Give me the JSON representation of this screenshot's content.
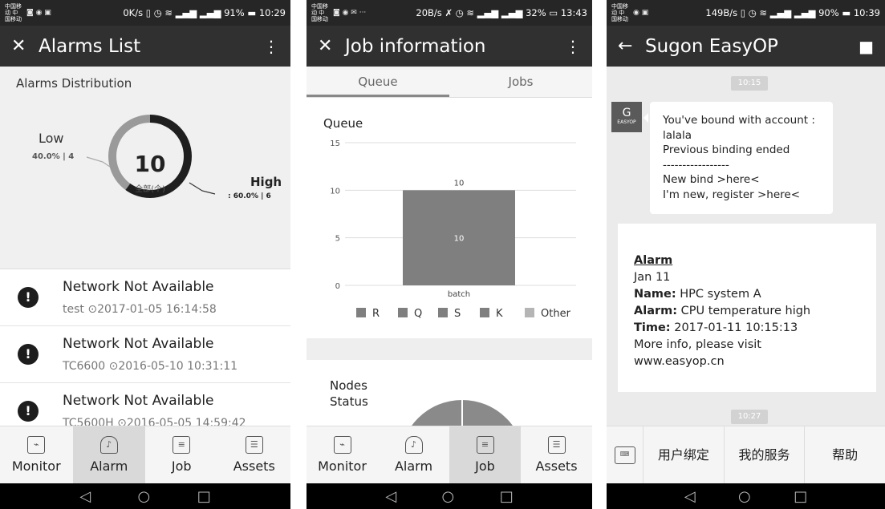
{
  "screens": [
    {
      "status": {
        "carrier": "中国移动\n中国移动",
        "speed": "0K/s",
        "battery": "91%",
        "time": "10:29"
      },
      "appbar": {
        "nav": "✕",
        "title": "Alarms List",
        "menu": "⋮"
      },
      "distribution": {
        "title": "Alarms Distribution",
        "total": "10",
        "unit": "全部(个)",
        "low_label": "Low",
        "low_value": "40.0% | 4",
        "high_label": "High",
        "high_value": ": 60.0% | 6",
        "high_fraction": 0.6
      },
      "alarms": [
        {
          "name": "Network Not Available",
          "meta": "test ⊙2017-01-05 16:14:58"
        },
        {
          "name": "Network Not Available",
          "meta": "TC6600 ⊙2016-05-10 10:31:11"
        },
        {
          "name": "Network Not Available",
          "meta": "TC5600H ⊙2016-05-05 14:59:42"
        }
      ],
      "tabs": [
        "Monitor",
        "Alarm",
        "Job",
        "Assets"
      ],
      "active_tab": "Alarm"
    },
    {
      "status": {
        "carrier": "中国移动\n中国移动",
        "speed": "20B/s",
        "battery": "32%",
        "time": "13:43"
      },
      "appbar": {
        "nav": "✕",
        "title": "Job information",
        "menu": "⋮"
      },
      "top_tabs": [
        "Queue",
        "Jobs"
      ],
      "queue_title": "Queue",
      "nodes_title": "Nodes Status",
      "tabs": [
        "Monitor",
        "Alarm",
        "Job",
        "Assets"
      ],
      "active_tab": "Job"
    },
    {
      "status": {
        "carrier": "中国移动\n中国移动",
        "speed": "149B/s",
        "battery": "90%",
        "time": "10:39"
      },
      "appbar": {
        "nav": "←",
        "title": "Sugon EasyOP",
        "menu": "👤"
      },
      "time1": "10:15",
      "time2": "10:27",
      "avatar_text": "EASYOP",
      "bubble_lines": [
        "You've bound with account :",
        "lalala",
        "Previous binding ended",
        "-----------------",
        "New bind >here<",
        "I'm new, register >here<"
      ],
      "card": {
        "heading": "Alarm",
        "date": "Jan 11",
        "name_label": "Name:",
        "name_value": " HPC system A",
        "alarm_label": "Alarm:",
        "alarm_value": " CPU temperature high",
        "time_label": "Time:",
        "time_value": " 2017-01-11 10:15:13",
        "more": "More info, please visit",
        "url": "www.easyop.cn"
      },
      "menu": [
        "用户绑定",
        "我的服务",
        "帮助"
      ]
    }
  ],
  "chart_data": {
    "type": "bar",
    "title": "Queue",
    "categories": [
      "batch"
    ],
    "series": [
      {
        "name": "R",
        "values": [
          0
        ]
      },
      {
        "name": "Q",
        "values": [
          10
        ]
      },
      {
        "name": "S",
        "values": [
          0
        ]
      },
      {
        "name": "K",
        "values": [
          0
        ]
      },
      {
        "name": "Other",
        "values": [
          0
        ]
      }
    ],
    "data_labels": [
      "10",
      "10"
    ],
    "yticks": [
      "0",
      "5",
      "10",
      "15"
    ],
    "ylim": [
      0,
      15
    ],
    "legend_position": "bottom",
    "colors": {
      "bar": "#7f7f7f",
      "other": "#b5b5b5"
    }
  }
}
